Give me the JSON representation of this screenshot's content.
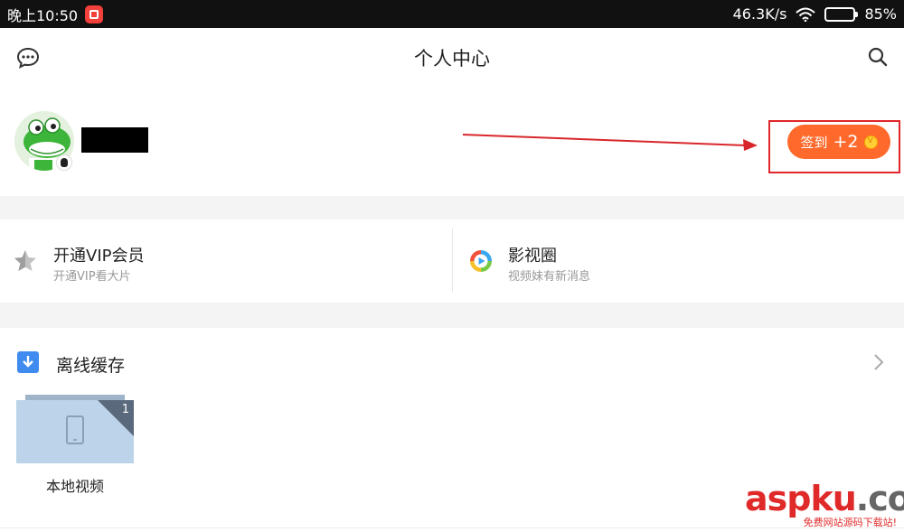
{
  "status_bar": {
    "time": "晚上10:50",
    "network_speed": "46.3K/s",
    "battery_percent": "85%",
    "battery_level": 0.85
  },
  "header": {
    "title": "个人中心"
  },
  "profile": {
    "checkin_label": "签到",
    "checkin_reward": "+2"
  },
  "cards": [
    {
      "title": "开通VIP会员",
      "subtitle": "开通VIP看大片",
      "icon": "star-icon"
    },
    {
      "title": "影视圈",
      "subtitle": "视频妹有新消息",
      "icon": "play-circle-icon"
    }
  ],
  "offline": {
    "title": "离线缓存",
    "folder_label": "本地视频",
    "folder_count": "1"
  },
  "watermark": {
    "part1": "asp",
    "part2": "ku",
    "part3": ".com",
    "subtitle": "免费网站源码下载站!"
  },
  "colors": {
    "accent_orange": "#ff6a2c",
    "annotation_red": "#e0262a",
    "download_blue": "#3f8bf0"
  }
}
